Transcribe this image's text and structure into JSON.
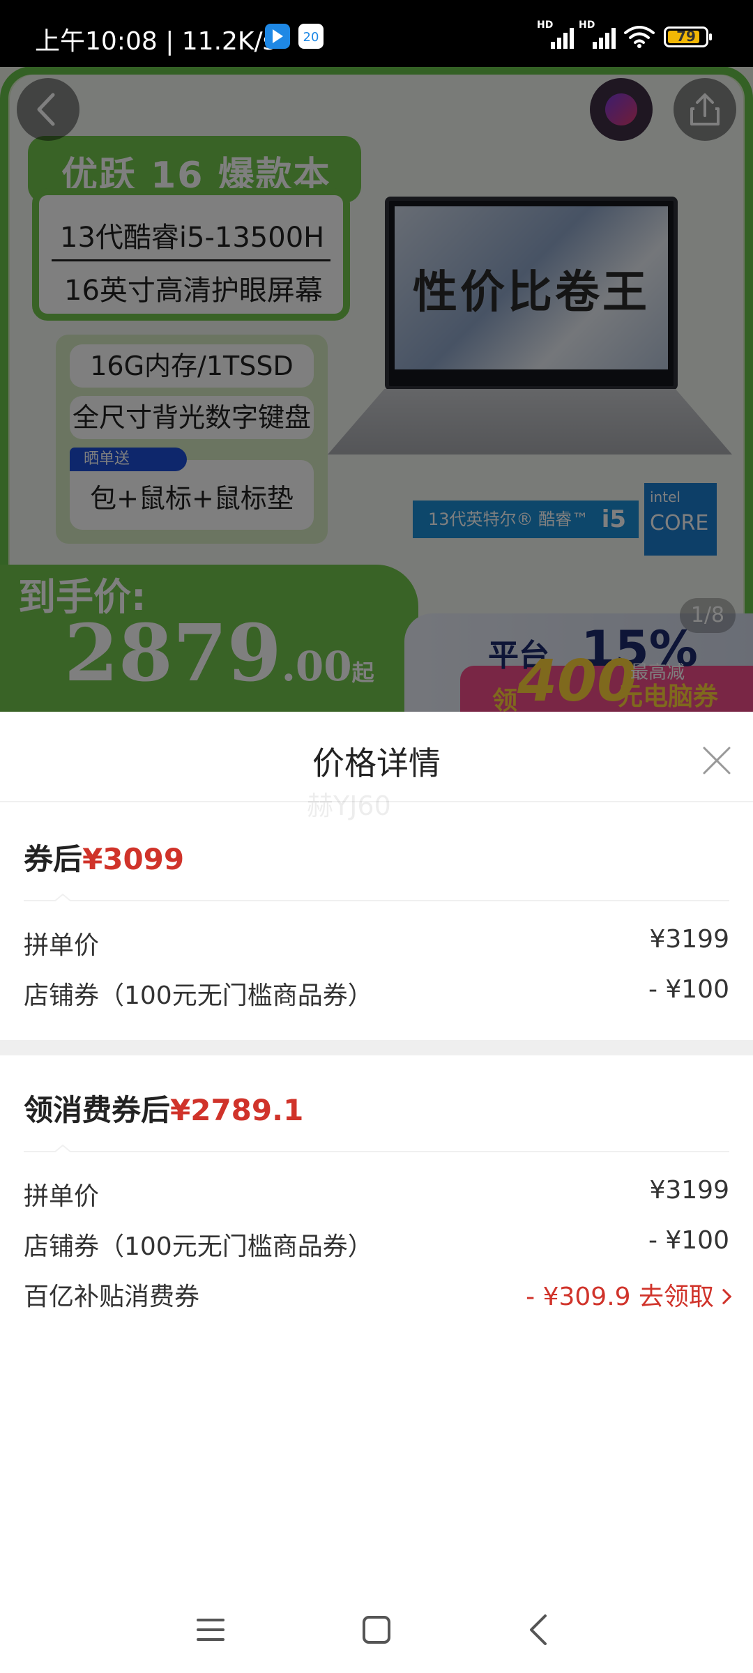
{
  "status_bar": {
    "time": "上午10:08",
    "network_speed": "| 11.2K/s",
    "app_badge": "20",
    "signal_label": "HD",
    "battery": "79"
  },
  "product": {
    "title": "优跃 16 爆款本",
    "cpu_spec": "13代酷睿i5-13500H",
    "screen_spec": "16英寸高清护眼屏幕",
    "memory_spec": "16G内存/1TSSD",
    "keyboard_spec": "全尺寸背光数字键盘",
    "gift_tag": "晒单送",
    "gift_items": "包+鼠标+鼠标垫",
    "screen_slogan": "性价比卷王",
    "intel_label": "13代英特尔® 酷睿™",
    "intel_model": "i5",
    "intel_brand": "intel",
    "intel_core": "CORE",
    "price_label": "到手价:",
    "price_int": "2879",
    "price_dec": ".00",
    "price_suffix": "起",
    "promo_headline": "平台",
    "promo_percent": "15%",
    "promo_claim": "领",
    "promo_amount": "400",
    "promo_unit": "元电脑券",
    "promo_max": "最高减",
    "image_counter": "1/8"
  },
  "sheet": {
    "title": "价格详情",
    "watermark": "赫YJ60",
    "section1": {
      "title": "券后",
      "price": "¥3099",
      "rows": [
        {
          "label": "拼单价",
          "value": "¥3199"
        },
        {
          "label": "店铺券（100元无门槛商品券）",
          "value": "- ¥100"
        }
      ]
    },
    "section2": {
      "title": "领消费券后",
      "price": "¥2789.1",
      "rows": [
        {
          "label": "拼单价",
          "value": "¥3199"
        },
        {
          "label": "店铺券（100元无门槛商品券）",
          "value": "- ¥100"
        },
        {
          "label": "百亿补贴消费券",
          "value": "- ¥309.9 去领取"
        }
      ]
    }
  },
  "colors": {
    "accent_red": "#d0332a",
    "brand_green": "#72c64d",
    "divider_gray": "#efefef"
  },
  "icons": {
    "back": "chevron-left-icon",
    "share": "share-icon",
    "close": "close-icon",
    "nav_menu": "menu-icon",
    "nav_home": "home-square-icon",
    "nav_back": "back-triangle-icon"
  }
}
